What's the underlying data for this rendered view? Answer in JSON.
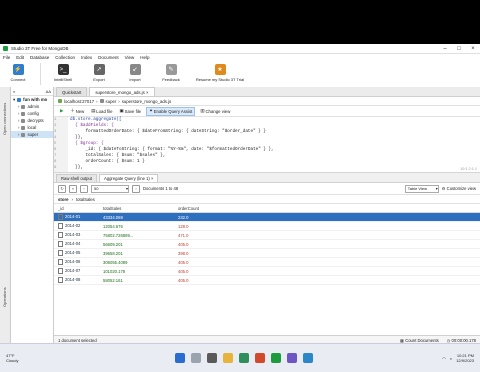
{
  "window": {
    "title": "Studio 3T Free for MongoDB"
  },
  "menu": [
    "File",
    "Edit",
    "Database",
    "Collection",
    "Index",
    "Document",
    "View",
    "Help"
  ],
  "toolbar": [
    {
      "label": "Connect",
      "icon": "connect-icon",
      "color": "#2e7dd1"
    },
    {
      "label": "IntelliShell",
      "icon": "shell-icon",
      "color": "#333333"
    },
    {
      "label": "Export",
      "icon": "export-icon",
      "color": "#555555"
    },
    {
      "label": "Import",
      "icon": "import-icon",
      "color": "#777777"
    },
    {
      "label": "Feedback",
      "icon": "feedback-icon",
      "color": "#888888"
    },
    {
      "label": "Resume my Studio 3T Trial",
      "icon": "trial-icon",
      "color": "#e08a1e"
    }
  ],
  "left_strip": {
    "top": "Open connections",
    "bottom": "Operations"
  },
  "sidebar": {
    "filter": "AA",
    "root": "fun with mo",
    "items": [
      "admin",
      "config",
      "decrypts",
      "local",
      "super"
    ]
  },
  "tabs": [
    "Quickstart",
    "superstore_mongo_ads.js"
  ],
  "breadcrumb": {
    "host": "localhost:27017",
    "db": "super",
    "file": "superstore_mongo_ads.js"
  },
  "query_toolbar": [
    "New",
    "Load file",
    "Save file",
    "Enable Query Assist",
    "Change view"
  ],
  "editor": {
    "gutter": [
      "1",
      "2",
      "3",
      "4",
      "5",
      "6",
      "7",
      "8",
      "9",
      "10"
    ],
    "lines": [
      "db.store.aggregate([",
      "  { $addFields: {",
      "      formattedOrderDate: { $dateFromString: { dateString: \"$order_date\" } }",
      "  }},",
      "  { $group: {",
      "      _id: { $dateToString: { format: \"%Y-%m\", date: \"$formattedOrderDate\" } },",
      "      totalSales: { $sum: \"$sales\" },",
      "      orderCount: { $sum: 1 }",
      "  }},",
      ""
    ],
    "position": "10:1 2:1 1"
  },
  "result_tabs": [
    "Raw shell output",
    "Aggregate Query (line 1)"
  ],
  "results_nav": {
    "page_size": "50",
    "documents": "Documents 1 to 48",
    "view": "Table View",
    "customize": "Customize view"
  },
  "path": {
    "collection": "store",
    "field": "totalSales"
  },
  "columns": [
    "_id",
    "totalSales",
    "orderCount"
  ],
  "rows": [
    {
      "id": "2014-01",
      "total": "43334.069",
      "count": "232.0",
      "selected": true
    },
    {
      "id": "2014-02",
      "total": "12054.676",
      "count": "128.0"
    },
    {
      "id": "2014-03",
      "total": "75802.726889...",
      "count": "471.0"
    },
    {
      "id": "2014-04",
      "total": "56609.201",
      "count": "405.0"
    },
    {
      "id": "2014-05",
      "total": "39658.201",
      "count": "398.0"
    },
    {
      "id": "2014-06",
      "total": "306055.4089",
      "count": "405.0"
    },
    {
      "id": "2014-07",
      "total": "101020.178",
      "count": "405.0"
    },
    {
      "id": "2014-08",
      "total": "58052.161",
      "count": "405.0"
    }
  ],
  "status": {
    "left": "1 document selected",
    "count": "Count Documents",
    "time": "00:00:00.178"
  },
  "taskbar": {
    "weather_temp": "47°F",
    "weather_desc": "Cloudy",
    "time": "10:21 PM",
    "date": "12/9/2023"
  }
}
